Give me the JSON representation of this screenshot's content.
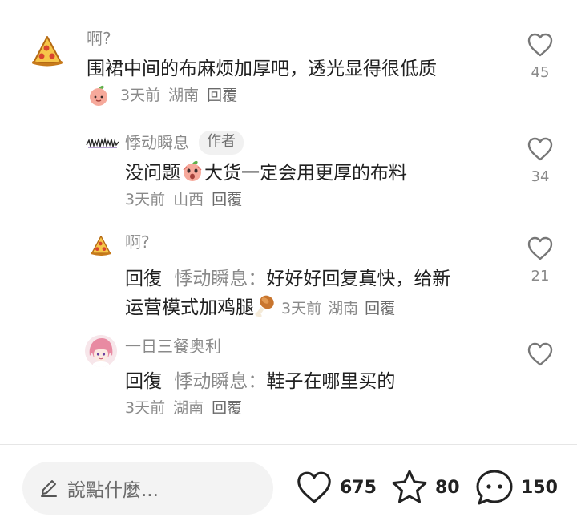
{
  "comments": [
    {
      "username": "啊?",
      "text": "围裙中间的布麻烦加厚吧，透光显得很低质",
      "time": "3天前",
      "location": "湖南",
      "reply_label": "回覆",
      "likes": "45",
      "avatar_icon": "pizza-slice-icon",
      "meta_icon": "peach-face-icon"
    },
    {
      "username": "悸动瞬息",
      "tag": "作者",
      "text_before": "没问题",
      "text_after": "大货一定会用更厚的布料",
      "time": "3天前",
      "location": "山西",
      "reply_label": "回覆",
      "likes": "34",
      "avatar_icon": "signature-logo-icon",
      "inline_icon": "peach-shocked-icon"
    },
    {
      "username": "啊?",
      "reply_prefix": "回復",
      "reply_target": "悸动瞬息：",
      "text_line1": "好好好回复真快，给新",
      "text_line2": "运营模式加鸡腿",
      "time": "3天前",
      "location": "湖南",
      "reply_label": "回覆",
      "likes": "21",
      "avatar_icon": "pizza-slice-icon",
      "inline_icon": "drumstick-icon"
    },
    {
      "username": "一日三餐奥利",
      "reply_prefix": "回復",
      "reply_target": "悸动瞬息：",
      "text": "鞋子在哪里买的",
      "time": "3天前",
      "location": "湖南",
      "reply_label": "回覆",
      "avatar_icon": "anime-girl-avatar"
    }
  ],
  "bottom_bar": {
    "input_placeholder": "說點什麼...",
    "like_count": "675",
    "star_count": "80",
    "comment_count": "150"
  },
  "colors": {
    "text": "#202020",
    "muted": "#8a8a8a",
    "input_bg": "#f3f3f3",
    "tag_bg": "#f1f1f1"
  }
}
